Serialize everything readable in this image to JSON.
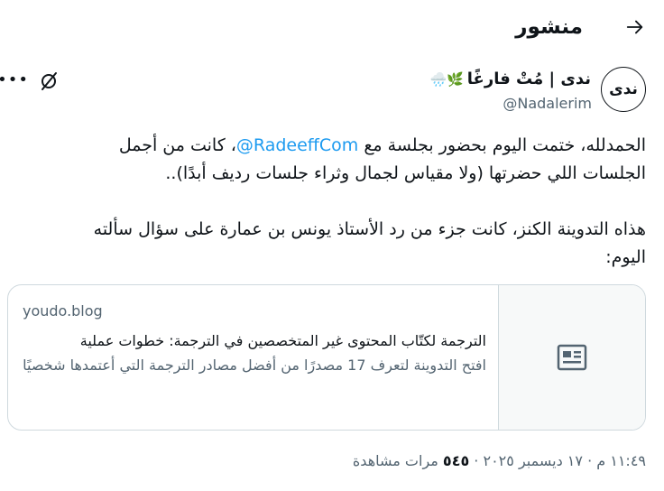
{
  "header": {
    "title": "منشور",
    "back_icon": "arrow-right-icon"
  },
  "author": {
    "avatar_text": "ندى",
    "name": "ندى | مُتْ فارغًا",
    "name_emojis": "🌿🌧️",
    "handle": "@Nadalerim"
  },
  "tweet": {
    "paragraph1_before": "الحمدلله، ختمت اليوم بحضور بجلسة مع ",
    "mention": "@RadeeffCom",
    "paragraph1_after": "، كانت من أجمل الجلسات اللي حضرتها (ولا مقياس لجمال وثراء جلسات رديف أبدًا)..",
    "paragraph2": "هذاه التدوينة الكنز، كانت جزء من رد الأستاذ يونس بن عمارة على سؤال سألته اليوم:"
  },
  "card": {
    "domain": "youdo.blog",
    "title": "الترجمة لكتّاب المحتوى غير المتخصصين في الترجمة: خطوات عملية",
    "description": "افتح التدوينة لتعرف 17 مصدرًا من أفضل مصادر الترجمة التي أعتمدها شخصيًا",
    "thumb_icon": "article-icon"
  },
  "meta": {
    "timestamp": "١١:٤٩ م · ١٧ ديسمبر ٢٠٢٥ · ",
    "views_count": "٥٤٥",
    "views_label": " مرات مشاهدة"
  },
  "colors": {
    "accent": "#1d9bf0",
    "secondary_text": "#536471",
    "border": "#cfd9de"
  }
}
